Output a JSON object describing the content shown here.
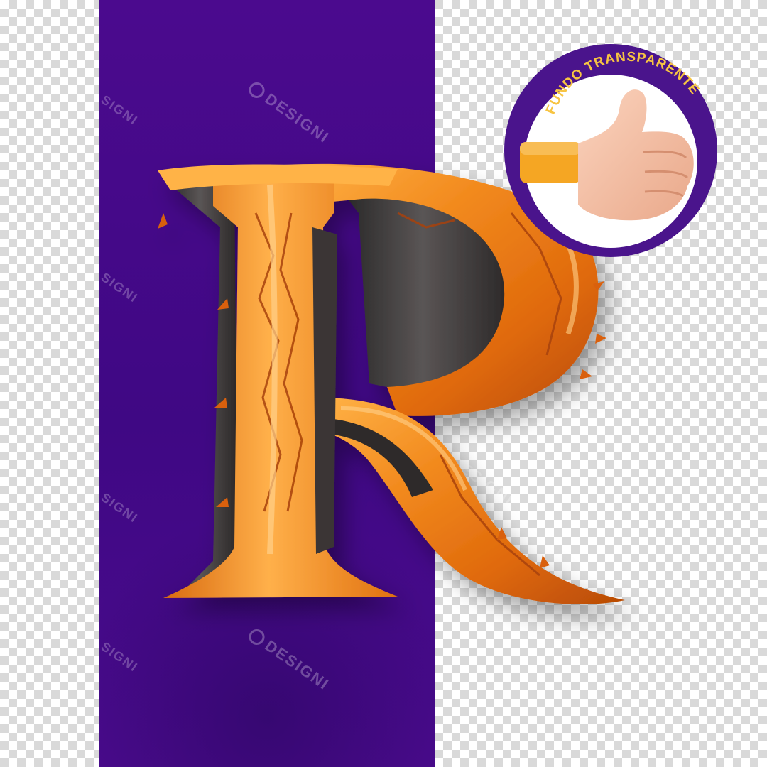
{
  "badge": {
    "text": "FUNDO TRANSPARENTE",
    "icon": "thumbs-up-icon"
  },
  "letter": {
    "glyph": "R",
    "icon": "letter-r-3d-icon"
  },
  "watermark": {
    "text": "DESIGNI",
    "edge_text": "SIGNI",
    "icon": "designi-logo-icon"
  },
  "colors": {
    "panel": "#4a0a8c",
    "letter_orange": "#f28a1e",
    "letter_dark": "#3a3535",
    "badge_circle": "#4a148c",
    "badge_text": "#f7c442",
    "hand_skin": "#f6c2a6",
    "sleeve": "#f5a623"
  }
}
